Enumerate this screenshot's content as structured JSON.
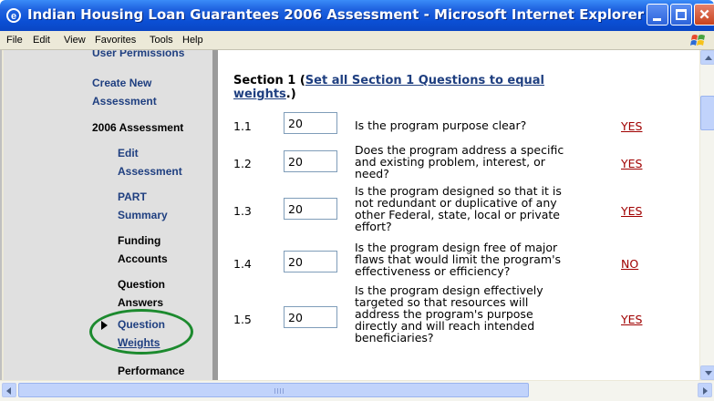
{
  "window": {
    "title": "Indian Housing Loan Guarantees 2006 Assessment - Microsoft Internet Explorer",
    "icon": "ie-icon"
  },
  "menu": {
    "items": [
      "File",
      "Edit",
      "View",
      "Favorites",
      "Tools",
      "Help"
    ]
  },
  "nav": {
    "cut_off": "User Permissions",
    "create_new_1": "Create New",
    "create_new_2": "Assessment",
    "assessment_2006": "2006 Assessment",
    "edit_1": "Edit",
    "edit_2": "Assessment",
    "part_1": "PART",
    "part_2": "Summary",
    "funding_1": "Funding",
    "funding_2": "Accounts",
    "question_1": "Question",
    "question_2": "Answers",
    "weights_1": "Question",
    "weights_2": "Weights",
    "performance": "Performance"
  },
  "main": {
    "section_prefix": "Section 1 (",
    "section_link_1": "Set all Section 1 Questions to equal",
    "section_link_2": "weights",
    "section_suffix": ".)",
    "questions": [
      {
        "num": "1.1",
        "weight": "20",
        "text": [
          "Is the program purpose clear?"
        ],
        "answer": "YES"
      },
      {
        "num": "1.2",
        "weight": "20",
        "text": [
          "Does the program address a specific",
          "and existing problem, interest, or",
          "need?"
        ],
        "answer": "YES"
      },
      {
        "num": "1.3",
        "weight": "20",
        "text": [
          "Is the program designed so that it is",
          "not redundant or duplicative of any",
          "other Federal, state, local or private",
          "effort?"
        ],
        "answer": "YES"
      },
      {
        "num": "1.4",
        "weight": "20",
        "text": [
          "Is the program design free of major",
          "flaws that would limit the program's",
          "effectiveness or efficiency?"
        ],
        "answer": "NO"
      },
      {
        "num": "1.5",
        "weight": "20",
        "text": [
          "Is the program design effectively",
          "targeted so that resources will",
          "address the program's purpose",
          "directly and will reach intended",
          "beneficiaries?"
        ],
        "answer": "YES"
      }
    ]
  },
  "colors": {
    "nav_link": "#1f3f80",
    "answer": "#a00000",
    "highlight_circle": "#1c8a2e"
  }
}
